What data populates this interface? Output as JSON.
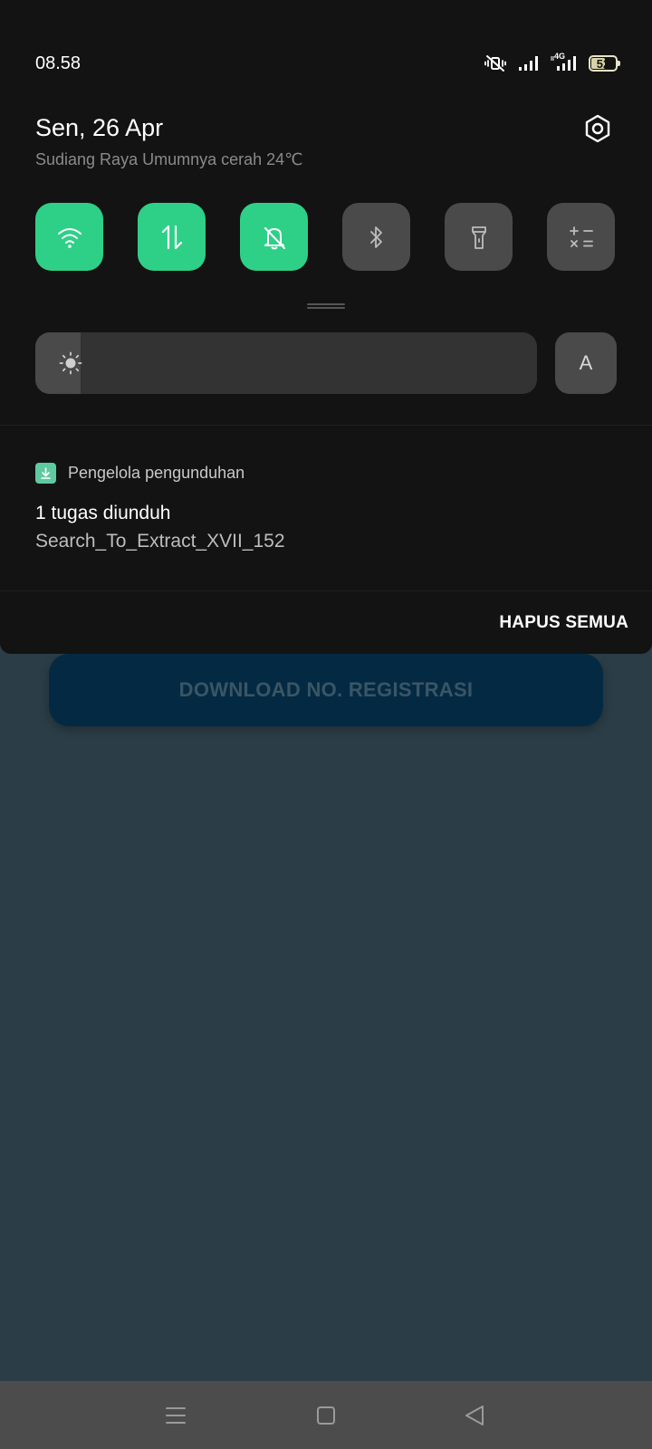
{
  "status_bar": {
    "time": "08.58",
    "icons": [
      "mute-vibrate-icon",
      "signal-icon",
      "4g-signal-icon",
      "battery-icon"
    ],
    "network_label": "4G",
    "battery_level": "52"
  },
  "header": {
    "date": "Sen, 26 Apr",
    "weather": "Sudiang Raya Umumnya cerah 24℃"
  },
  "quick_tiles": [
    {
      "icon": "wifi-icon",
      "state": "on"
    },
    {
      "icon": "mobile-data-icon",
      "state": "on"
    },
    {
      "icon": "bell-off-icon",
      "state": "on"
    },
    {
      "icon": "bluetooth-icon",
      "state": "off"
    },
    {
      "icon": "flashlight-icon",
      "state": "off"
    },
    {
      "icon": "calculator-icon",
      "state": "off"
    }
  ],
  "brightness": {
    "level_fraction": 0.09,
    "auto_label": "A"
  },
  "notification": {
    "app_name": "Pengelola pengunduhan",
    "title": "1 tugas diunduh",
    "text": "Search_To_Extract_XVII_152"
  },
  "clear_all_label": "HAPUS SEMUA",
  "background_app": {
    "button_label": "DOWNLOAD NO. REGISTRASI"
  },
  "colors": {
    "tile_on": "#2ed087",
    "tile_off": "#4a4a4a",
    "shade_bg": "#131313",
    "app_bg": "#2b3d46",
    "app_button": "#042a43"
  },
  "nav_bar": {
    "buttons": [
      "menu-icon",
      "home-icon",
      "back-icon"
    ]
  }
}
